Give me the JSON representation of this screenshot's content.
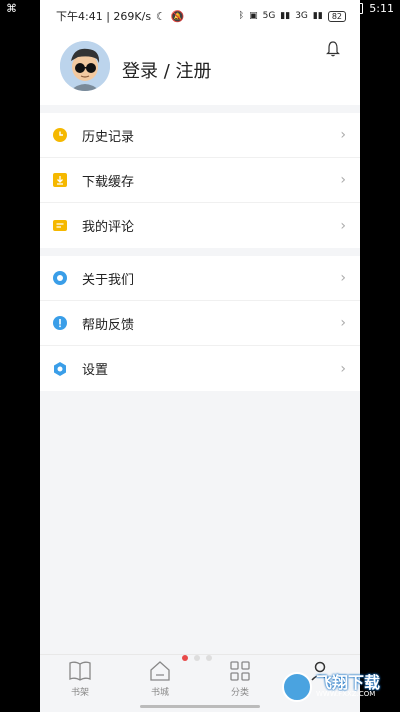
{
  "outer": {
    "time": "5:11"
  },
  "status": {
    "left_text": "下午4:41 | 269K/s",
    "battery": "82",
    "net1": "5G",
    "net2": "3G"
  },
  "profile": {
    "login_label": "登录 / 注册"
  },
  "menu_group1": [
    {
      "label": "历史记录",
      "icon": "clock-icon",
      "color": "#f5b800"
    },
    {
      "label": "下载缓存",
      "icon": "download-icon",
      "color": "#f5b800"
    },
    {
      "label": "我的评论",
      "icon": "comment-icon",
      "color": "#f5b800"
    }
  ],
  "menu_group2": [
    {
      "label": "关于我们",
      "icon": "info-circle-icon",
      "color": "#3a9ee8"
    },
    {
      "label": "帮助反馈",
      "icon": "help-icon",
      "color": "#3a9ee8"
    },
    {
      "label": "设置",
      "icon": "settings-icon",
      "color": "#3a9ee8"
    }
  ],
  "bottom_nav": [
    {
      "label": "书架",
      "icon": "book-icon"
    },
    {
      "label": "书城",
      "icon": "store-icon"
    },
    {
      "label": "分类",
      "icon": "grid-icon"
    },
    {
      "label": "",
      "icon": "user-icon"
    }
  ],
  "watermark": {
    "text": "飞翔下载",
    "sub": "WWW.FXXZ.COM"
  }
}
